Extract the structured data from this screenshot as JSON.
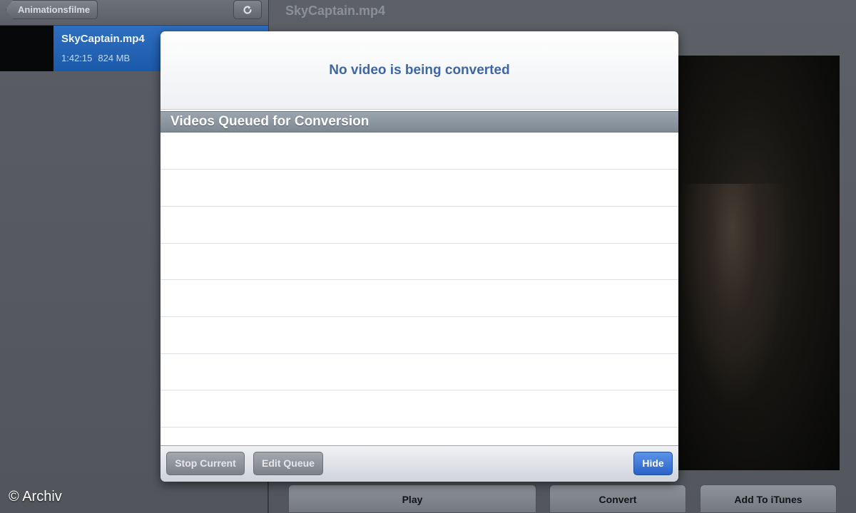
{
  "left_pane": {
    "back_label": "Animationsfilme",
    "file": {
      "name": "SkyCaptain.mp4",
      "duration": "1:42:15",
      "size": "824 MB"
    }
  },
  "right_pane": {
    "title": "SkyCaptain.mp4",
    "buttons": {
      "play": "Play",
      "convert": "Convert",
      "add_to_itunes": "Add To iTunes"
    }
  },
  "popover": {
    "status": "No video is being converted",
    "queue_header": "Videos Queued for Conversion",
    "queue_items": [],
    "toolbar": {
      "stop_current": "Stop Current",
      "edit_queue": "Edit Queue",
      "hide": "Hide"
    }
  },
  "watermark": "© Archiv",
  "colors": {
    "selection_blue": "#1b59ab",
    "status_text": "#3f67a6",
    "hide_button": "#2a63c9"
  }
}
